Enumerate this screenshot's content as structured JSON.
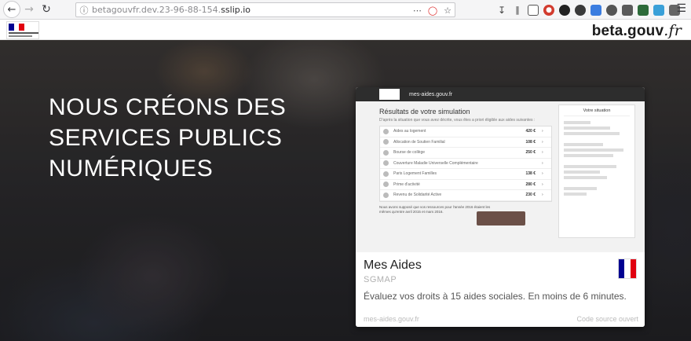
{
  "browser": {
    "url_host": "betagouvfr.dev.23-96-88-154.",
    "url_domain": "sslip.io",
    "icons": [
      "back-icon",
      "forward-icon",
      "reload-icon",
      "info-icon",
      "more-icon",
      "pocket-icon",
      "bookmark-star-icon",
      "download-icon",
      "library-icon",
      "sidebar-icon",
      "extension-icon",
      "menu-icon"
    ]
  },
  "site": {
    "brand_main": "beta.gouv",
    "brand_tld": ".fr"
  },
  "hero": {
    "title": "NOUS CRÉONS DES SERVICES PUBLICS NUMÉRIQUES"
  },
  "card": {
    "screenshot": {
      "site_name": "mes-aides.gouv.fr",
      "title": "Résultats de votre simulation",
      "subtitle": "D'après la situation que vous avez décrite, vous êtes a priori éligible aux aides suivantes :",
      "rows": [
        {
          "label": "Aides au logement",
          "amount": "420 €"
        },
        {
          "label": "Allocation de Soutien Familial",
          "amount": "108 €"
        },
        {
          "label": "Bourse de collège",
          "amount": "250 €"
        },
        {
          "label": "Couverture Maladie Universelle Complémentaire",
          "amount": ""
        },
        {
          "label": "Paris Logement Familles",
          "amount": "138 €"
        },
        {
          "label": "Prime d'activité",
          "amount": "280 €"
        },
        {
          "label": "Revenu de Solidarité Active",
          "amount": "230 €"
        }
      ],
      "note": "Nous avons supposé que vos ressources pour l'année 2016 étaient les mêmes qu'entre avril 2015 et mars 2016.",
      "side_title": "Votre situation"
    },
    "title": "Mes Aides",
    "org": "SGMAP",
    "description": "Évaluez vos droits à 15 aides sociales. En moins de 6 minutes.",
    "link_left": "mes-aides.gouv.fr",
    "link_right": "Code source ouvert"
  },
  "colors": {
    "flag_blue": "#000091",
    "flag_white": "#ffffff",
    "flag_red": "#e1000f"
  }
}
